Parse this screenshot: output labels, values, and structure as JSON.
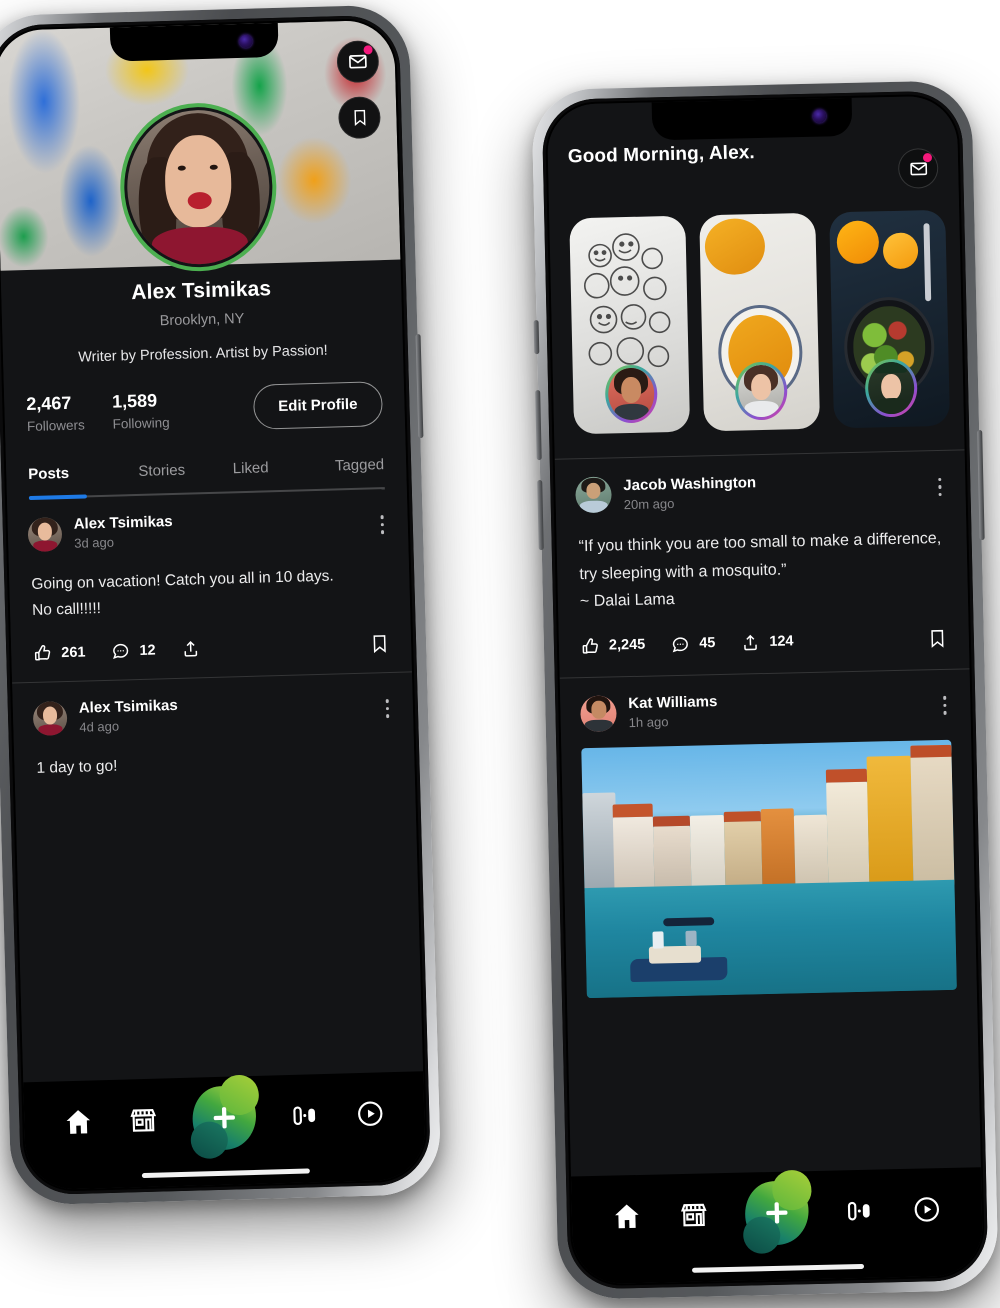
{
  "left_phone": {
    "app_name": "social-profile",
    "cover": {
      "alt": "paint-splatter-cover"
    },
    "header_icons": [
      {
        "name": "messages-icon",
        "badge": true
      },
      {
        "name": "bookmark-icon",
        "badge": false
      }
    ],
    "profile": {
      "name": "Alex Tsimikas",
      "location": "Brooklyn, NY",
      "bio": "Writer by Profession. Artist by Passion!",
      "avatar_ring_color": "#4caf50"
    },
    "stats": [
      {
        "value": "2,467",
        "label": "Followers"
      },
      {
        "value": "1,589",
        "label": "Following"
      }
    ],
    "edit_button": "Edit Profile",
    "tabs": [
      {
        "label": "Posts",
        "active": true
      },
      {
        "label": "Stories",
        "active": false
      },
      {
        "label": "Liked",
        "active": false
      },
      {
        "label": "Tagged",
        "active": false
      }
    ],
    "tab_active_color": "#1e7ae6",
    "posts": [
      {
        "author": "Alex Tsimikas",
        "time": "3d ago",
        "text_line1": "Going on vacation! Catch you all in 10 days.",
        "text_line2": "No call!!!!!",
        "likes": "261",
        "comments": "12",
        "shares": ""
      },
      {
        "author": "Alex Tsimikas",
        "time": "4d ago",
        "text_line1": "1 day to go!",
        "text_line2": "",
        "likes": "",
        "comments": "",
        "shares": ""
      }
    ],
    "nav": [
      {
        "name": "home-icon",
        "label": "Home"
      },
      {
        "name": "store-icon",
        "label": "Store"
      },
      {
        "name": "add-icon",
        "label": "Add"
      },
      {
        "name": "audio-icon",
        "label": "Audio"
      },
      {
        "name": "video-icon",
        "label": "Video"
      }
    ]
  },
  "right_phone": {
    "app_name": "social-feed",
    "greeting": "Good Morning, Alex.",
    "messages_icon": {
      "name": "messages-icon",
      "badge": true
    },
    "stories": [
      {
        "name": "story-doodle",
        "alt": "doodle-sketch"
      },
      {
        "name": "story-soup",
        "alt": "pumpkin-soup"
      },
      {
        "name": "story-salad",
        "alt": "salad-bowl"
      },
      {
        "name": "story-next",
        "alt": "partial-card"
      }
    ],
    "posts": [
      {
        "author": "Jacob Washington",
        "time": "20m ago",
        "quote_line1": "“If you think you are too small to make a",
        "quote_line2": "difference, try sleeping with a mosquito.”",
        "quote_line3": "~ Dalai Lama",
        "likes": "2,245",
        "comments": "45",
        "shares": "124",
        "has_image": false
      },
      {
        "author": "Kat Williams",
        "time": "1h ago",
        "quote_line1": "",
        "quote_line2": "",
        "quote_line3": "",
        "likes": "",
        "comments": "",
        "shares": "",
        "has_image": true,
        "image_alt": "venice-grand-canal"
      }
    ],
    "nav": [
      {
        "name": "home-icon",
        "label": "Home"
      },
      {
        "name": "store-icon",
        "label": "Store"
      },
      {
        "name": "add-icon",
        "label": "Add"
      },
      {
        "name": "audio-icon",
        "label": "Audio"
      },
      {
        "name": "video-icon",
        "label": "Video"
      }
    ]
  },
  "theme": {
    "bg": "#131416",
    "nav_bg": "#000000",
    "accent_blue": "#1e7ae6",
    "badge_pink": "#f5197c",
    "fab_gradient_from": "#0c5148",
    "fab_gradient_to": "#b5d335"
  }
}
